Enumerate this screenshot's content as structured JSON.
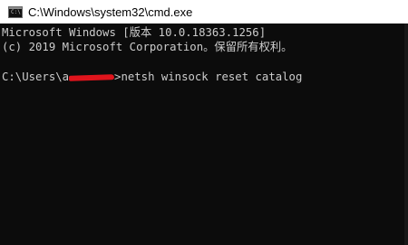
{
  "window": {
    "title": "C:\\Windows\\system32\\cmd.exe",
    "icon": "C:\\"
  },
  "console": {
    "line1": "Microsoft Windows [版本 10.0.18363.1256]",
    "line2": "(c) 2019 Microsoft Corporation。保留所有权利。",
    "line3": "",
    "prompt_prefix": "C:\\Users\\a",
    "prompt_suffix": ">",
    "command": "netsh winsock reset catalog"
  },
  "colors": {
    "background": "#0c0c0c",
    "text": "#cccccc",
    "titlebar": "#ffffff",
    "redaction": "#e0141c"
  }
}
